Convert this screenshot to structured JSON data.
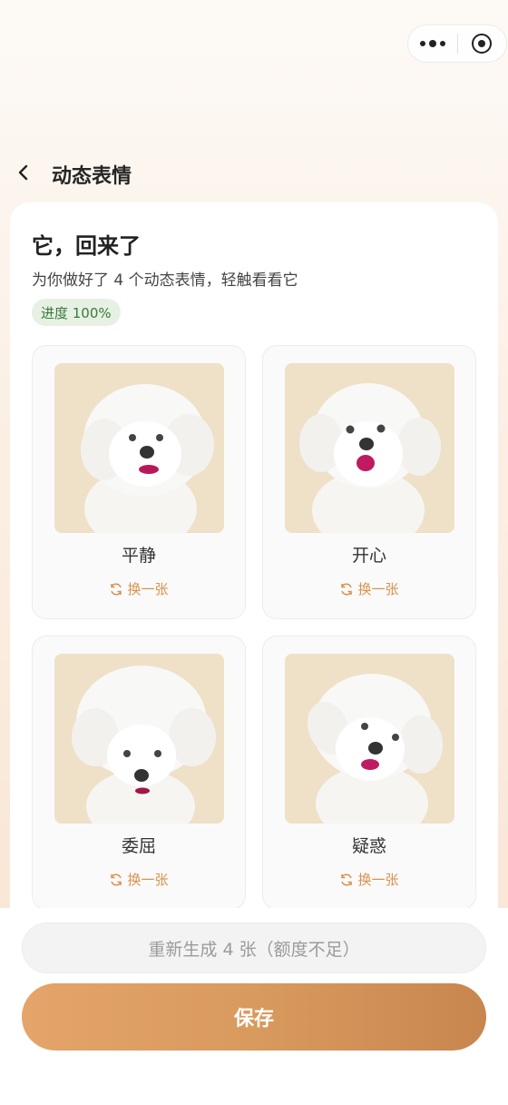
{
  "nav": {
    "title": "动态表情"
  },
  "header": {
    "title": "它，回来了",
    "subtitle": "为你做好了 4 个动态表情，轻触看看它",
    "progress_label": "进度 100%"
  },
  "expressions": [
    {
      "label": "平静",
      "swap_label": "换一张"
    },
    {
      "label": "开心",
      "swap_label": "换一张"
    },
    {
      "label": "委屈",
      "swap_label": "换一张"
    },
    {
      "label": "疑惑",
      "swap_label": "换一张"
    }
  ],
  "footer": {
    "regenerate_label": "重新生成 4 张（额度不足）",
    "save_label": "保存"
  },
  "colors": {
    "accent": "#d9924e",
    "save_gradient_start": "#e4a46a",
    "save_gradient_end": "#c8864f",
    "badge_bg": "#e6f1e4",
    "badge_text": "#3a7a3a",
    "photo_bg": "#efe0c8"
  },
  "icons": [
    "more-dots-icon",
    "target-icon",
    "back-chevron-icon",
    "refresh-icon"
  ]
}
